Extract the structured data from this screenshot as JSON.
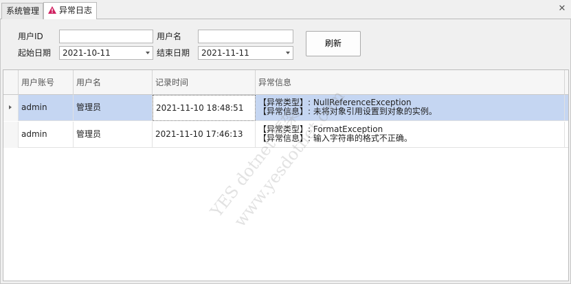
{
  "tabs": [
    {
      "label": "系统管理",
      "active": false
    },
    {
      "label": "异常日志",
      "active": true,
      "icon": "warning-icon"
    }
  ],
  "filters": {
    "user_id_label": "用户ID",
    "user_id_value": "",
    "user_name_label": "用户名",
    "user_name_value": "",
    "start_date_label": "起始日期",
    "start_date_value": "2021-10-11",
    "end_date_label": "结束日期",
    "end_date_value": "2021-11-11",
    "refresh_label": "刷新"
  },
  "grid": {
    "columns": [
      "用户账号",
      "用户名",
      "记录时间",
      "异常信息"
    ],
    "rows": [
      {
        "account": "admin",
        "name": "管理员",
        "time": "2021-11-10 18:48:51",
        "info_type": "【异常类型】: NullReferenceException",
        "info_msg": "【异常信息】: 未将对象引用设置到对象的实例。",
        "selected": true
      },
      {
        "account": "admin",
        "name": "管理员",
        "time": "2021-11-10 17:46:13",
        "info_type": "【异常类型】: FormatException",
        "info_msg": "【异常信息】: 输入字符串的格式不正确。",
        "selected": false
      }
    ]
  },
  "watermark": {
    "line1": "YES dotnet 框架",
    "line2": "www.yesdotnet.com"
  },
  "colors": {
    "selected_row": "#c5d6f2",
    "warning_icon": "#d02060"
  }
}
